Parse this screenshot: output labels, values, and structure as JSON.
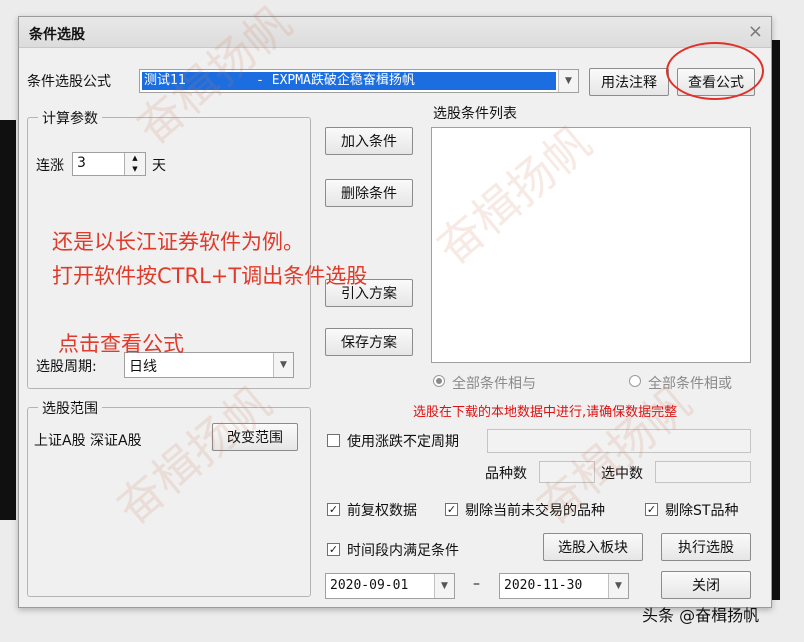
{
  "dialog": {
    "title": "条件选股",
    "close_glyph": "×"
  },
  "formula": {
    "label": "条件选股公式",
    "selected": "测试11         - EXPMA跌破企稳奋楫扬帆",
    "usage_button": "用法注释",
    "view_button": "查看公式"
  },
  "params": {
    "legend": "计算参数",
    "consecutive_label": "连涨",
    "consecutive_value": "3",
    "unit": "天",
    "period_label": "选股周期:",
    "period_value": "日线"
  },
  "actions": {
    "add": "加入条件",
    "delete": "删除条件",
    "import": "引入方案",
    "save": "保存方案"
  },
  "conditions": {
    "label": "选股条件列表",
    "radio_and": "全部条件相与",
    "radio_or": "全部条件相或",
    "notice": "选股在下载的本地数据中进行,请确保数据完整"
  },
  "range": {
    "legend": "选股范围",
    "value": "上证A股 深证A股",
    "change_button": "改变范围"
  },
  "options": {
    "variable_period": "使用涨跌不定周期",
    "count_label": "品种数",
    "selected_label": "选中数",
    "forward_adjust": "前复权数据",
    "exclude_untraded": "剔除当前未交易的品种",
    "exclude_st": "剔除ST品种",
    "time_period": "时间段内满足条件",
    "date_from": "2020-09-01",
    "date_dash": "–",
    "date_to": "2020-11-30"
  },
  "buttons": {
    "to_block": "选股入板块",
    "execute": "执行选股",
    "close": "关闭"
  },
  "annotation": {
    "line1": "还是以长江证券软件为例。",
    "line2": "打开软件按CTRL+T调出条件选股",
    "line3": "点击查看公式"
  },
  "watermark": {
    "text": "奋楫扬帆",
    "footer": "头条 @奋楫扬帆"
  },
  "colors": {
    "accent_selection": "#1c6ee0",
    "annotation_red": "#e03a2a",
    "notice_red": "#e01010"
  }
}
